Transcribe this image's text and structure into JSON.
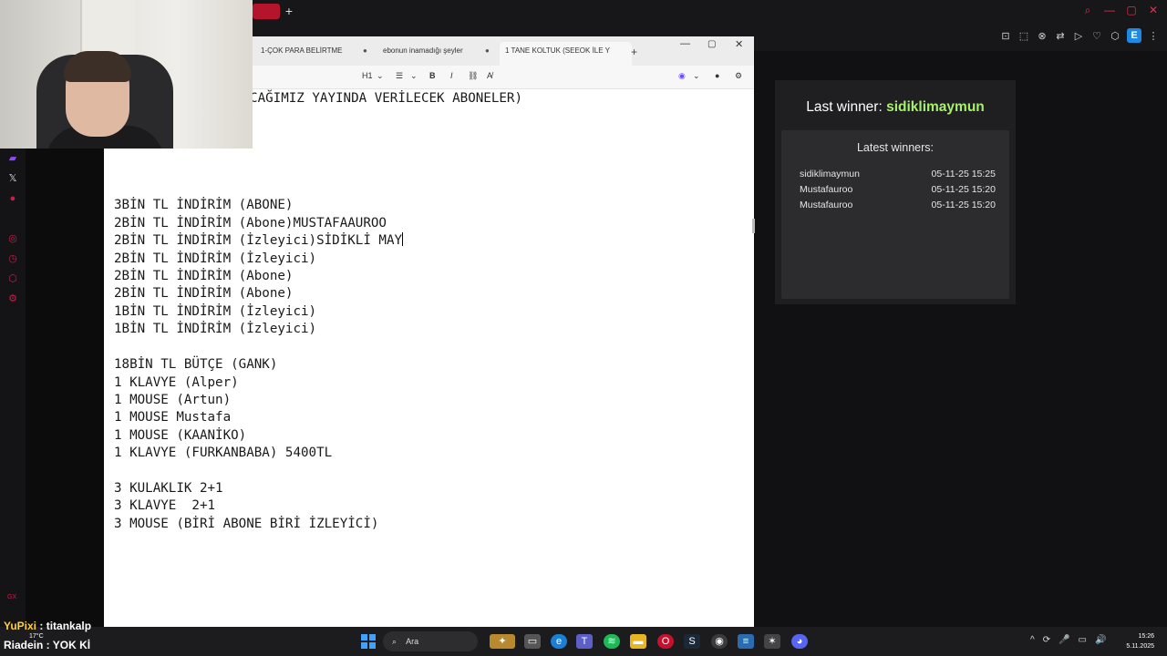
{
  "browser": {
    "new_tab": "+",
    "window_controls": [
      "⌕",
      "—",
      "▢",
      "✕"
    ],
    "toolbar_icons": [
      "⊡",
      "⬚",
      "⊗",
      "⇄",
      "▷",
      "♡",
      "⬡"
    ],
    "profile": "E",
    "more": "⋮"
  },
  "sidebar": {
    "icons": [
      "twitch-icon",
      "x-icon",
      "music-icon",
      "spacer",
      "record-icon",
      "clock-icon",
      "cube-icon",
      "gear-icon"
    ],
    "gx": "GX"
  },
  "winners": {
    "last_winner_label": "Last winner:",
    "last_winner_name": "sidiklimaymun",
    "latest_title": "Latest winners:",
    "rows": [
      {
        "name": "sidiklimaymun",
        "time": "05-11-25 15:25"
      },
      {
        "name": "Mustafauroo",
        "time": "05-11-25 15:20"
      },
      {
        "name": "Mustafauroo",
        "time": "05-11-25 15:20"
      }
    ]
  },
  "notepad": {
    "tabs": [
      {
        "label": "1-ÇOK PARA BELİRTME"
      },
      {
        "label": "ebonun inamadığı şeyler"
      },
      {
        "label": "1 TANE KOLTUK (SEEOK İLE Y"
      }
    ],
    "new_tab": "+",
    "minimize": "—",
    "maximize": "▢",
    "close": "✕",
    "toolbar": {
      "heading": "H1",
      "heading_caret": "⌄",
      "list": "☰",
      "list_caret": "⌄",
      "bold": "B",
      "italic": "I",
      "link": "⛓",
      "clear": "A̸",
      "copilot": "◉",
      "copilot_caret": "⌄",
      "account": "●",
      "settings": "⚙"
    },
    "first_line": "EEOK İLE YAPACAĞIMIZ YAYINDA VERİLECEK ABONELER)",
    "lines": [
      "3BİN TL İNDİRİM (ABONE)",
      "2BİN TL İNDİRİM (Abone)MUSTAFAAUROO",
      "2BİN TL İNDİRİM (İzleyici)SİDİKLİ MAY",
      "2BİN TL İNDİRİM (İzleyici)",
      "2BİN TL İNDİRİM (Abone)",
      "2BİN TL İNDİRİM (Abone)",
      "1BİN TL İNDİRİM (İzleyici)",
      "1BİN TL İNDİRİM (İzleyici)",
      "",
      "18BİN TL BÜTÇE (GANK)",
      "1 KLAVYE (Alper)",
      "1 MOUSE (Artun)",
      "1 MOUSE Mustafa",
      "1 MOUSE (KAANİKO)",
      "1 KLAVYE (FURKANBABA) 5400TL",
      "",
      "3 KULAKLIK 2+1",
      "3 KLAVYE  2+1",
      "3 MOUSE (BİRİ ABONE BİRİ İZLEYİCİ)"
    ]
  },
  "chat": {
    "user": "YuPixi",
    "separator": " : ",
    "message": "titankalp",
    "line2": "Riadein : YOK Kİ",
    "weather": "17°C"
  },
  "taskbar": {
    "search_placeholder": "Ara",
    "search_icon": "⌕",
    "tray": [
      "^",
      "⟳",
      "🎤",
      "▭",
      "🔊"
    ],
    "time": "15:26",
    "date": "5.11.2025"
  }
}
